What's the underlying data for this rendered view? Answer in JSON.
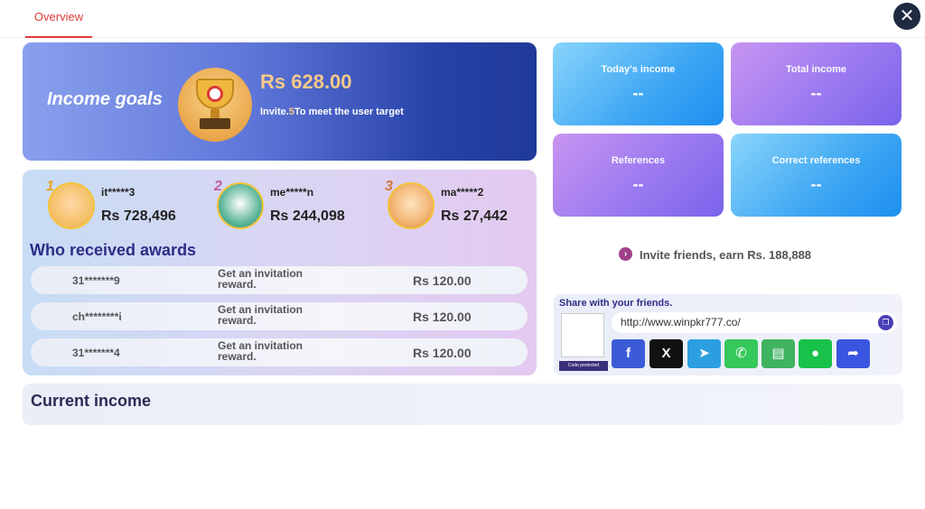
{
  "tabs": [
    {
      "label": "Overview"
    }
  ],
  "close_symbol": "✕",
  "goals": {
    "title": "Income goals",
    "amount": "Rs 628.00",
    "invite_prefix": "Invite.",
    "invite_count": "5",
    "invite_suffix": "To meet the user target"
  },
  "stats": [
    {
      "label": "Today's income",
      "value": "--"
    },
    {
      "label": "Total income",
      "value": "--"
    },
    {
      "label": "References",
      "value": "--"
    },
    {
      "label": "Correct references",
      "value": "--"
    }
  ],
  "leaderboard": [
    {
      "rank": "1",
      "name": "it*****3",
      "amount": "Rs 728,496"
    },
    {
      "rank": "2",
      "name": "me*****n",
      "amount": "Rs 244,098"
    },
    {
      "rank": "3",
      "name": "ma*****2",
      "amount": "Rs 27,442"
    }
  ],
  "awards": {
    "title": "Who received awards",
    "rows": [
      {
        "user": "31*******9",
        "desc": "Get an invitation reward.",
        "amount": "Rs  120.00"
      },
      {
        "user": "ch********i",
        "desc": "Get an invitation reward.",
        "amount": "Rs  120.00"
      },
      {
        "user": "31*******4",
        "desc": "Get an invitation reward.",
        "amount": "Rs  120.00"
      }
    ]
  },
  "invite": {
    "text": "Invite friends, earn Rs. 188,888"
  },
  "share": {
    "title": "Share with your friends.",
    "url": "http://www.winpkr777.co/",
    "qr_caption": "Code protected",
    "buttons": [
      {
        "name": "facebook-icon",
        "glyph": "f",
        "color": "#3b5bd6"
      },
      {
        "name": "x-icon",
        "glyph": "X",
        "color": "#111111"
      },
      {
        "name": "telegram-icon",
        "glyph": "➤",
        "color": "#2c9fe0"
      },
      {
        "name": "whatsapp-icon",
        "glyph": "✆",
        "color": "#35c85a"
      },
      {
        "name": "sms-icon",
        "glyph": "▤",
        "color": "#3fb360"
      },
      {
        "name": "line-icon",
        "glyph": "●",
        "color": "#19c24a"
      },
      {
        "name": "share-icon",
        "glyph": "➦",
        "color": "#3a55e0"
      }
    ]
  },
  "current_income": {
    "title": "Current income"
  }
}
